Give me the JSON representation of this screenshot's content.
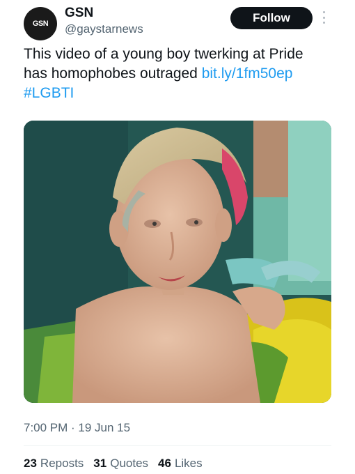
{
  "author": {
    "name": "GSN",
    "handle": "@gaystarnews",
    "logo_text": "GSN"
  },
  "follow_label": "Follow",
  "tweet": {
    "text": "This video of a young boy twerking at Pride has homophobes outraged ",
    "link": "bit.ly/1fm50ep",
    "hashtag": "#LGBTI"
  },
  "timestamp": {
    "time": "7:00 PM",
    "separator": " · ",
    "date": "19 Jun 15"
  },
  "stats": {
    "reposts_count": "23",
    "reposts_label": "Reposts",
    "quotes_count": "31",
    "quotes_label": "Quotes",
    "likes_count": "46",
    "likes_label": "Likes"
  },
  "colors": {
    "link": "#1d9bf0",
    "text": "#0f1419",
    "secondary": "#536471"
  }
}
